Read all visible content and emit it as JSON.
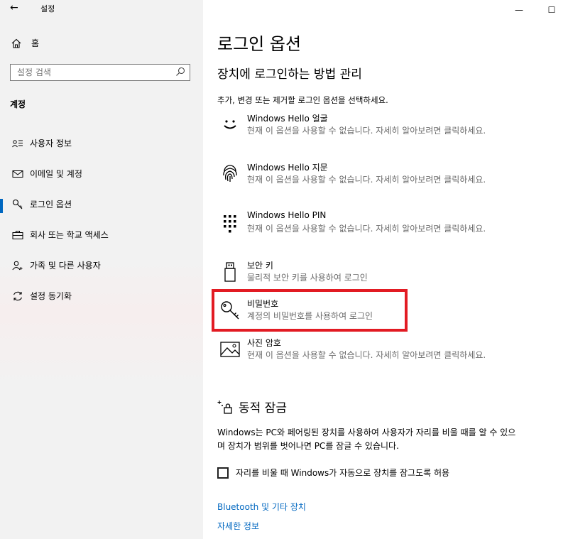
{
  "window": {
    "back_glyph": "←",
    "title": "설정",
    "minimize_glyph": "—",
    "maximize_glyph": "☐"
  },
  "sidebar": {
    "home_label": "홈",
    "search_placeholder": "설정 검색",
    "section": "계정",
    "items": [
      {
        "label": "사용자 정보",
        "icon": "person-info-icon"
      },
      {
        "label": "이메일 및 계정",
        "icon": "mail-icon"
      },
      {
        "label": "로그인 옵션",
        "icon": "key-icon"
      },
      {
        "label": "회사 또는 학교 액세스",
        "icon": "briefcase-icon"
      },
      {
        "label": "가족 및 다른 사용자",
        "icon": "person-add-icon"
      },
      {
        "label": "설정 동기화",
        "icon": "sync-icon"
      }
    ],
    "active_index": 2
  },
  "main": {
    "title": "로그인 옵션",
    "subtitle": "장치에 로그인하는 방법 관리",
    "intro": "추가, 변경 또는 제거할 로그인 옵션을 선택하세요.",
    "options": [
      {
        "title": "Windows Hello 얼굴",
        "desc": "현재 이 옵션을 사용할 수 없습니다. 자세히 알아보려면 클릭하세요.",
        "icon": "face-icon"
      },
      {
        "title": "Windows Hello 지문",
        "desc": "현재 이 옵션을 사용할 수 없습니다. 자세히 알아보려면 클릭하세요.",
        "icon": "fingerprint-icon"
      },
      {
        "title": "Windows Hello PIN",
        "desc": "현재 이 옵션을 사용할 수 없습니다. 자세히 알아보려면 클릭하세요.",
        "icon": "pin-keypad-icon"
      },
      {
        "title": "보안 키",
        "desc": "물리적 보안 키를 사용하여 로그인",
        "icon": "usb-key-icon"
      },
      {
        "title": "비밀번호",
        "desc": "계정의 비밀번호를 사용하여 로그인",
        "icon": "password-key-icon"
      },
      {
        "title": "사진 암호",
        "desc": "현재 이 옵션을 사용할 수 없습니다. 자세히 알아보려면 클릭하세요.",
        "icon": "picture-icon"
      }
    ],
    "dynamic_lock": {
      "title": "동적 잠금",
      "desc": "Windows는 PC와 페어링된 장치를 사용하여 사용자가 자리를 비울 때를 알 수 있으며 장치가 범위를 벗어나면 PC를 잠글 수 있습니다.",
      "checkbox_label": "자리를 비울 때 Windows가 자동으로 장치를 잠그도록 허용",
      "checked": false
    },
    "links": [
      "Bluetooth 및 기타 장치",
      "자세한 정보"
    ]
  },
  "colors": {
    "accent": "#0067c0",
    "highlight": "#e21b23"
  }
}
